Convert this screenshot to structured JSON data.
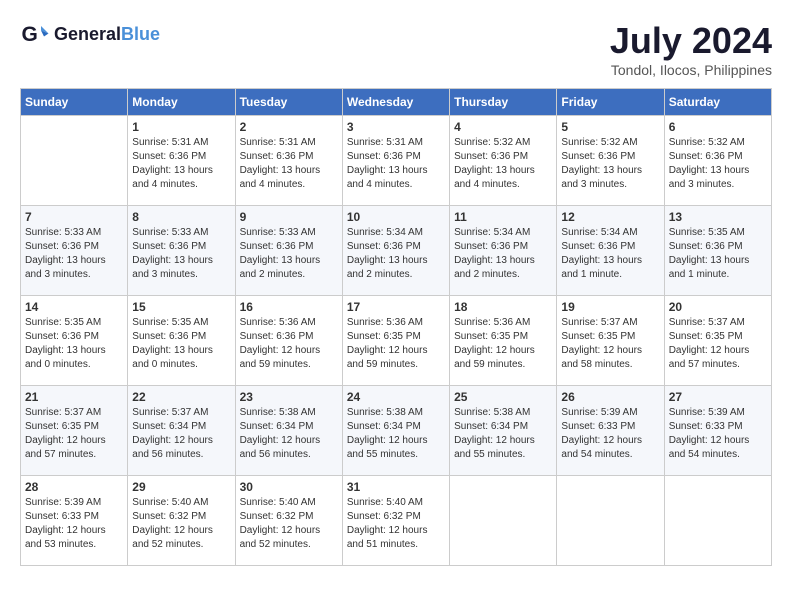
{
  "header": {
    "logo_line1": "General",
    "logo_line2": "Blue",
    "month_year": "July 2024",
    "location": "Tondol, Ilocos, Philippines"
  },
  "columns": [
    "Sunday",
    "Monday",
    "Tuesday",
    "Wednesday",
    "Thursday",
    "Friday",
    "Saturday"
  ],
  "weeks": [
    [
      {
        "day": "",
        "info": ""
      },
      {
        "day": "1",
        "info": "Sunrise: 5:31 AM\nSunset: 6:36 PM\nDaylight: 13 hours and 4 minutes."
      },
      {
        "day": "2",
        "info": "Sunrise: 5:31 AM\nSunset: 6:36 PM\nDaylight: 13 hours and 4 minutes."
      },
      {
        "day": "3",
        "info": "Sunrise: 5:31 AM\nSunset: 6:36 PM\nDaylight: 13 hours and 4 minutes."
      },
      {
        "day": "4",
        "info": "Sunrise: 5:32 AM\nSunset: 6:36 PM\nDaylight: 13 hours and 4 minutes."
      },
      {
        "day": "5",
        "info": "Sunrise: 5:32 AM\nSunset: 6:36 PM\nDaylight: 13 hours and 3 minutes."
      },
      {
        "day": "6",
        "info": "Sunrise: 5:32 AM\nSunset: 6:36 PM\nDaylight: 13 hours and 3 minutes."
      }
    ],
    [
      {
        "day": "7",
        "info": "Sunrise: 5:33 AM\nSunset: 6:36 PM\nDaylight: 13 hours and 3 minutes."
      },
      {
        "day": "8",
        "info": "Sunrise: 5:33 AM\nSunset: 6:36 PM\nDaylight: 13 hours and 3 minutes."
      },
      {
        "day": "9",
        "info": "Sunrise: 5:33 AM\nSunset: 6:36 PM\nDaylight: 13 hours and 2 minutes."
      },
      {
        "day": "10",
        "info": "Sunrise: 5:34 AM\nSunset: 6:36 PM\nDaylight: 13 hours and 2 minutes."
      },
      {
        "day": "11",
        "info": "Sunrise: 5:34 AM\nSunset: 6:36 PM\nDaylight: 13 hours and 2 minutes."
      },
      {
        "day": "12",
        "info": "Sunrise: 5:34 AM\nSunset: 6:36 PM\nDaylight: 13 hours and 1 minute."
      },
      {
        "day": "13",
        "info": "Sunrise: 5:35 AM\nSunset: 6:36 PM\nDaylight: 13 hours and 1 minute."
      }
    ],
    [
      {
        "day": "14",
        "info": "Sunrise: 5:35 AM\nSunset: 6:36 PM\nDaylight: 13 hours and 0 minutes."
      },
      {
        "day": "15",
        "info": "Sunrise: 5:35 AM\nSunset: 6:36 PM\nDaylight: 13 hours and 0 minutes."
      },
      {
        "day": "16",
        "info": "Sunrise: 5:36 AM\nSunset: 6:36 PM\nDaylight: 12 hours and 59 minutes."
      },
      {
        "day": "17",
        "info": "Sunrise: 5:36 AM\nSunset: 6:35 PM\nDaylight: 12 hours and 59 minutes."
      },
      {
        "day": "18",
        "info": "Sunrise: 5:36 AM\nSunset: 6:35 PM\nDaylight: 12 hours and 59 minutes."
      },
      {
        "day": "19",
        "info": "Sunrise: 5:37 AM\nSunset: 6:35 PM\nDaylight: 12 hours and 58 minutes."
      },
      {
        "day": "20",
        "info": "Sunrise: 5:37 AM\nSunset: 6:35 PM\nDaylight: 12 hours and 57 minutes."
      }
    ],
    [
      {
        "day": "21",
        "info": "Sunrise: 5:37 AM\nSunset: 6:35 PM\nDaylight: 12 hours and 57 minutes."
      },
      {
        "day": "22",
        "info": "Sunrise: 5:37 AM\nSunset: 6:34 PM\nDaylight: 12 hours and 56 minutes."
      },
      {
        "day": "23",
        "info": "Sunrise: 5:38 AM\nSunset: 6:34 PM\nDaylight: 12 hours and 56 minutes."
      },
      {
        "day": "24",
        "info": "Sunrise: 5:38 AM\nSunset: 6:34 PM\nDaylight: 12 hours and 55 minutes."
      },
      {
        "day": "25",
        "info": "Sunrise: 5:38 AM\nSunset: 6:34 PM\nDaylight: 12 hours and 55 minutes."
      },
      {
        "day": "26",
        "info": "Sunrise: 5:39 AM\nSunset: 6:33 PM\nDaylight: 12 hours and 54 minutes."
      },
      {
        "day": "27",
        "info": "Sunrise: 5:39 AM\nSunset: 6:33 PM\nDaylight: 12 hours and 54 minutes."
      }
    ],
    [
      {
        "day": "28",
        "info": "Sunrise: 5:39 AM\nSunset: 6:33 PM\nDaylight: 12 hours and 53 minutes."
      },
      {
        "day": "29",
        "info": "Sunrise: 5:40 AM\nSunset: 6:32 PM\nDaylight: 12 hours and 52 minutes."
      },
      {
        "day": "30",
        "info": "Sunrise: 5:40 AM\nSunset: 6:32 PM\nDaylight: 12 hours and 52 minutes."
      },
      {
        "day": "31",
        "info": "Sunrise: 5:40 AM\nSunset: 6:32 PM\nDaylight: 12 hours and 51 minutes."
      },
      {
        "day": "",
        "info": ""
      },
      {
        "day": "",
        "info": ""
      },
      {
        "day": "",
        "info": ""
      }
    ]
  ]
}
